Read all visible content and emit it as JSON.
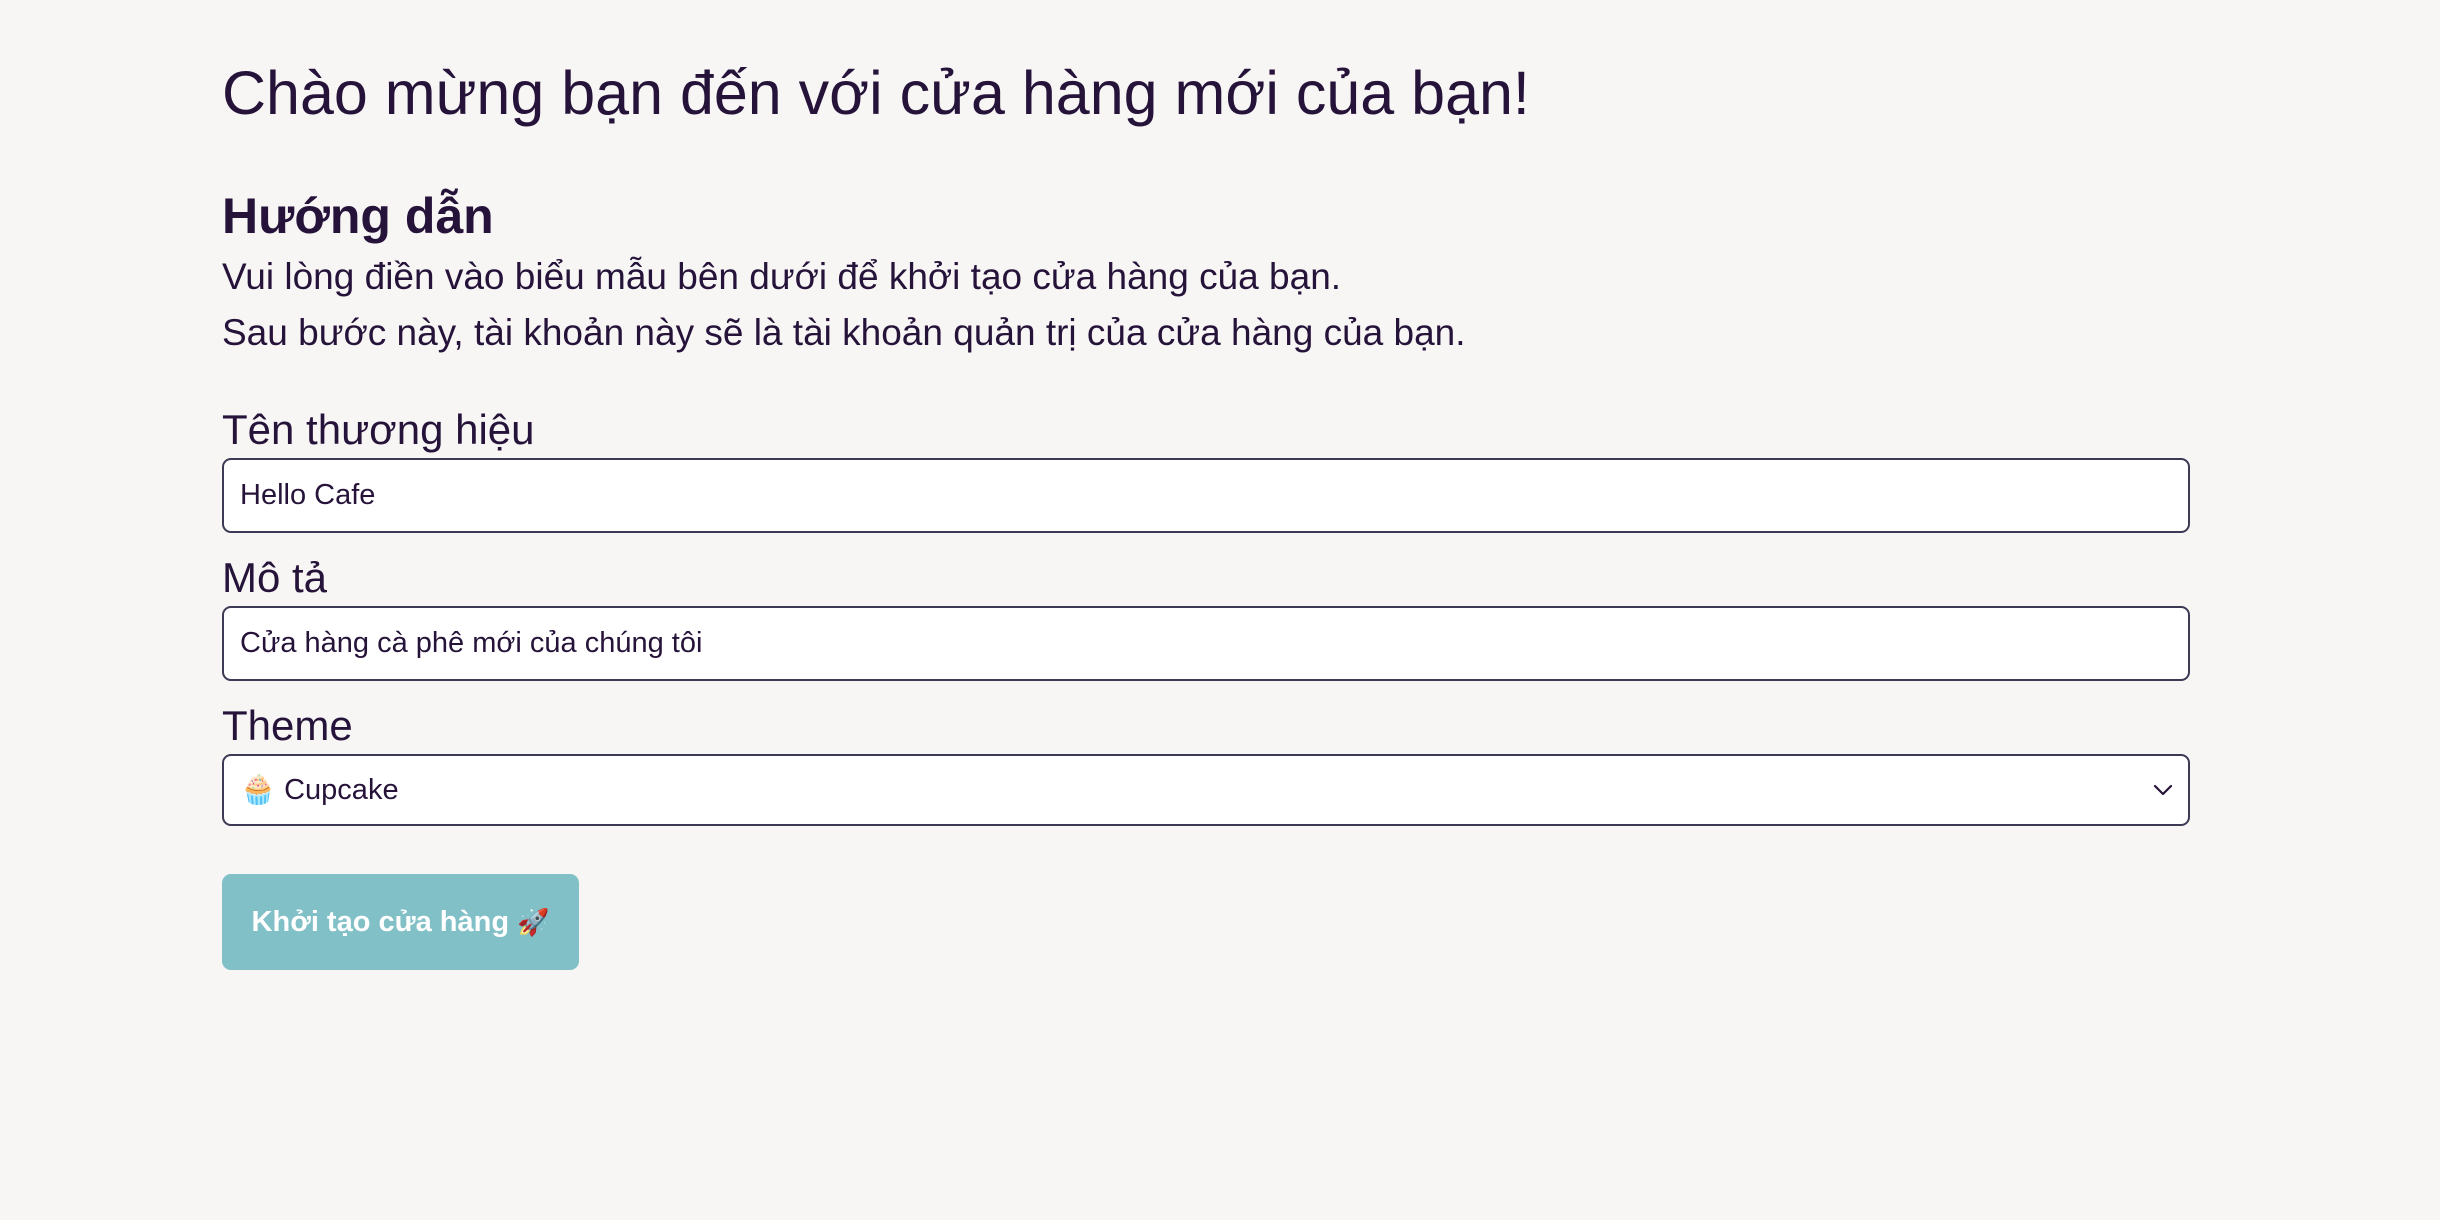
{
  "page": {
    "title": "Chào mừng bạn đến với cửa hàng mới của bạn!"
  },
  "instructions": {
    "heading": "Hướng dẫn",
    "line1": "Vui lòng điền vào biểu mẫu bên dưới để khởi tạo cửa hàng của bạn.",
    "line2": "Sau bước này, tài khoản này sẽ là tài khoản quản trị của cửa hàng của bạn."
  },
  "form": {
    "brand_name": {
      "label": "Tên thương hiệu",
      "value": "Hello Cafe"
    },
    "description": {
      "label": "Mô tả",
      "value": "Cửa hàng cà phê mới của chúng tôi"
    },
    "theme": {
      "label": "Theme",
      "icon": "🧁",
      "selected": "Cupcake"
    },
    "submit": {
      "label": "Khởi tạo cửa hàng",
      "icon": "🚀"
    }
  },
  "colors": {
    "background": "#f7f6f5",
    "text": "#26133a",
    "input_border": "#3c3a55",
    "button_bg": "#80c0c6",
    "button_text": "#ffffff"
  }
}
